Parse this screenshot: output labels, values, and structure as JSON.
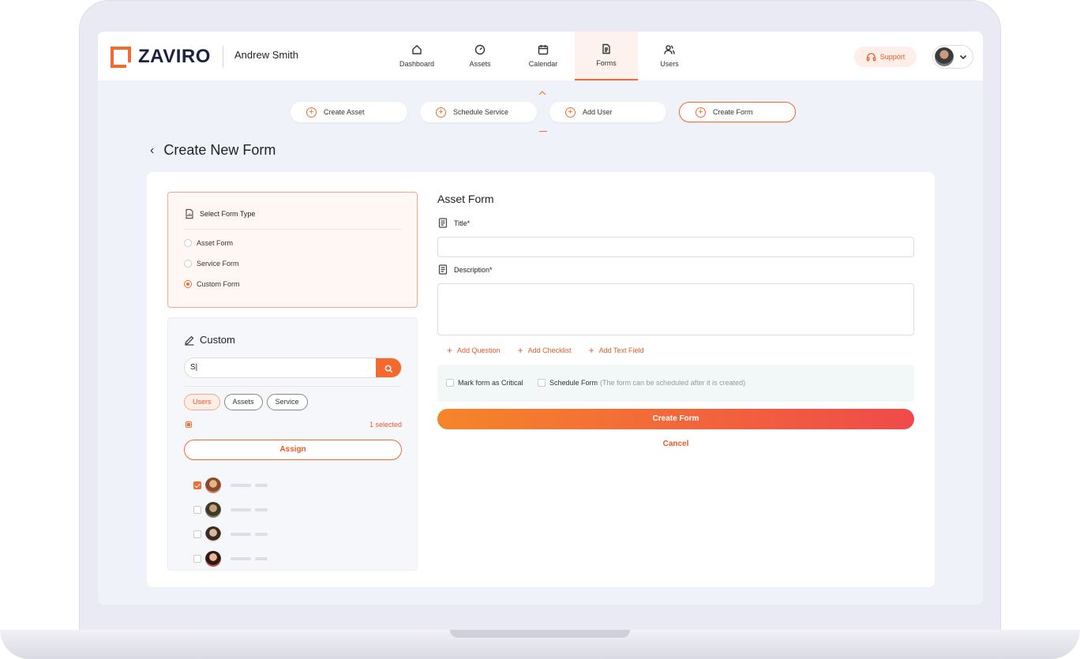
{
  "brand": {
    "name": "ZAVIRO",
    "accent": "#f26a2e"
  },
  "header": {
    "user_name": "Andrew Smith",
    "support_label": "Support",
    "nav": [
      {
        "label": "Dashboard",
        "icon": "home-icon"
      },
      {
        "label": "Assets",
        "icon": "gauge-icon"
      },
      {
        "label": "Calendar",
        "icon": "calendar-icon"
      },
      {
        "label": "Forms",
        "icon": "document-icon",
        "active": true
      },
      {
        "label": "Users",
        "icon": "users-icon"
      }
    ]
  },
  "quick_actions": [
    {
      "label": "Create Asset"
    },
    {
      "label": "Schedule Service"
    },
    {
      "label": "Add User"
    },
    {
      "label": "Create Form",
      "active": true
    }
  ],
  "page": {
    "title": "Create New Form"
  },
  "form_type": {
    "heading": "Select Form Type",
    "options": [
      "Asset Form",
      "Service Form",
      "Custom Form"
    ],
    "selected": "Custom Form"
  },
  "custom": {
    "heading": "Custom",
    "search_value": "S|",
    "filters": [
      "Users",
      "Assets",
      "Service"
    ],
    "active_filter": "Users",
    "selected_count": "1 selected",
    "assign_label": "Assign",
    "users": [
      {
        "checked": true,
        "avatar": "#c98c6a"
      },
      {
        "checked": false,
        "avatar": "#8a7a5a"
      },
      {
        "checked": false,
        "avatar": "#a98a78"
      },
      {
        "checked": false,
        "avatar": "#c64a3a"
      }
    ]
  },
  "form": {
    "title": "Asset Form",
    "title_label": "Title*",
    "title_value": "",
    "description_label": "Description*",
    "description_value": "",
    "add_question": "Add Question",
    "add_checklist": "Add Checklist",
    "add_text_field": "Add Text Field",
    "mark_critical": "Mark form as Critical",
    "schedule_form": "Schedule Form",
    "schedule_hint": "(The form can be scheduled after it is created)",
    "create_label": "Create Form",
    "cancel_label": "Cancel"
  }
}
